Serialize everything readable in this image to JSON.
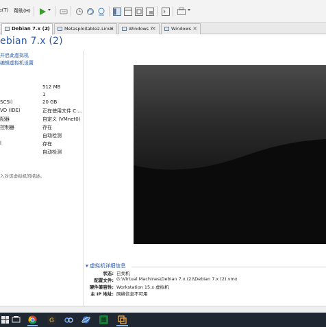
{
  "menu": {
    "view_label": "ɪ(T)",
    "help_label": "帮助(H)"
  },
  "toolbar": {
    "icons": [
      "play-icon",
      "send-keys-icon",
      "snapshot-icon",
      "revert-snapshot-icon",
      "manage-snapshots-icon",
      "library-view-icon",
      "thumbnail-view-icon",
      "fullscreen-icon",
      "unity-icon",
      "console-icon",
      "stretch-view-icon"
    ]
  },
  "tabs": [
    {
      "label": "Debian 7.x (2)",
      "active": true
    },
    {
      "label": "Metasploitable2-Linux",
      "active": false
    },
    {
      "label": "Windows 7",
      "active": false
    },
    {
      "label": "Windows",
      "active": false
    }
  ],
  "vm": {
    "title": "ebian 7.x (2)",
    "actions": [
      "开启此虚拟机",
      "编辑虚拟机设置"
    ],
    "devices": [
      {
        "name": "",
        "value": "512 MB"
      },
      {
        "name": "",
        "value": "1"
      },
      {
        "name": "SCSI)",
        "value": "20 GB"
      },
      {
        "name": "VD (IDE)",
        "value": "正在使用文件 C:..."
      },
      {
        "name": "配器",
        "value": "自定义 (VMnet0)"
      },
      {
        "name": "控制器",
        "value": "存在"
      },
      {
        "name": "",
        "value": "自动检测"
      },
      {
        "name": "l",
        "value": "存在"
      },
      {
        "name": "",
        "value": "自动检测"
      }
    ],
    "description": "入对该虚拟机的描述。"
  },
  "details": {
    "title": "虚拟机详细信息",
    "rows": [
      {
        "key": "状态:",
        "value": "已关机"
      },
      {
        "key": "配置文件:",
        "value": "G:\\Virtual Machines\\Debian 7.x (2)\\Debian 7.x (2).vmx"
      },
      {
        "key": "硬件兼容性:",
        "value": "Workstation 15.x 虚拟机"
      },
      {
        "key": "主 IP 地址:",
        "value": "网络信息不可用"
      }
    ]
  },
  "taskbar": {
    "apps": [
      "windows-start-icon",
      "task-view-icon",
      "chrome-icon",
      "g-app-icon",
      "baidu-netdisk-icon",
      "browser-icon",
      "terminal-icon",
      "vmware-icon"
    ]
  },
  "colors": {
    "accent": "#2a5aa8",
    "taskbar": "#1f2733",
    "preview_bg": "#0b0b0b"
  }
}
